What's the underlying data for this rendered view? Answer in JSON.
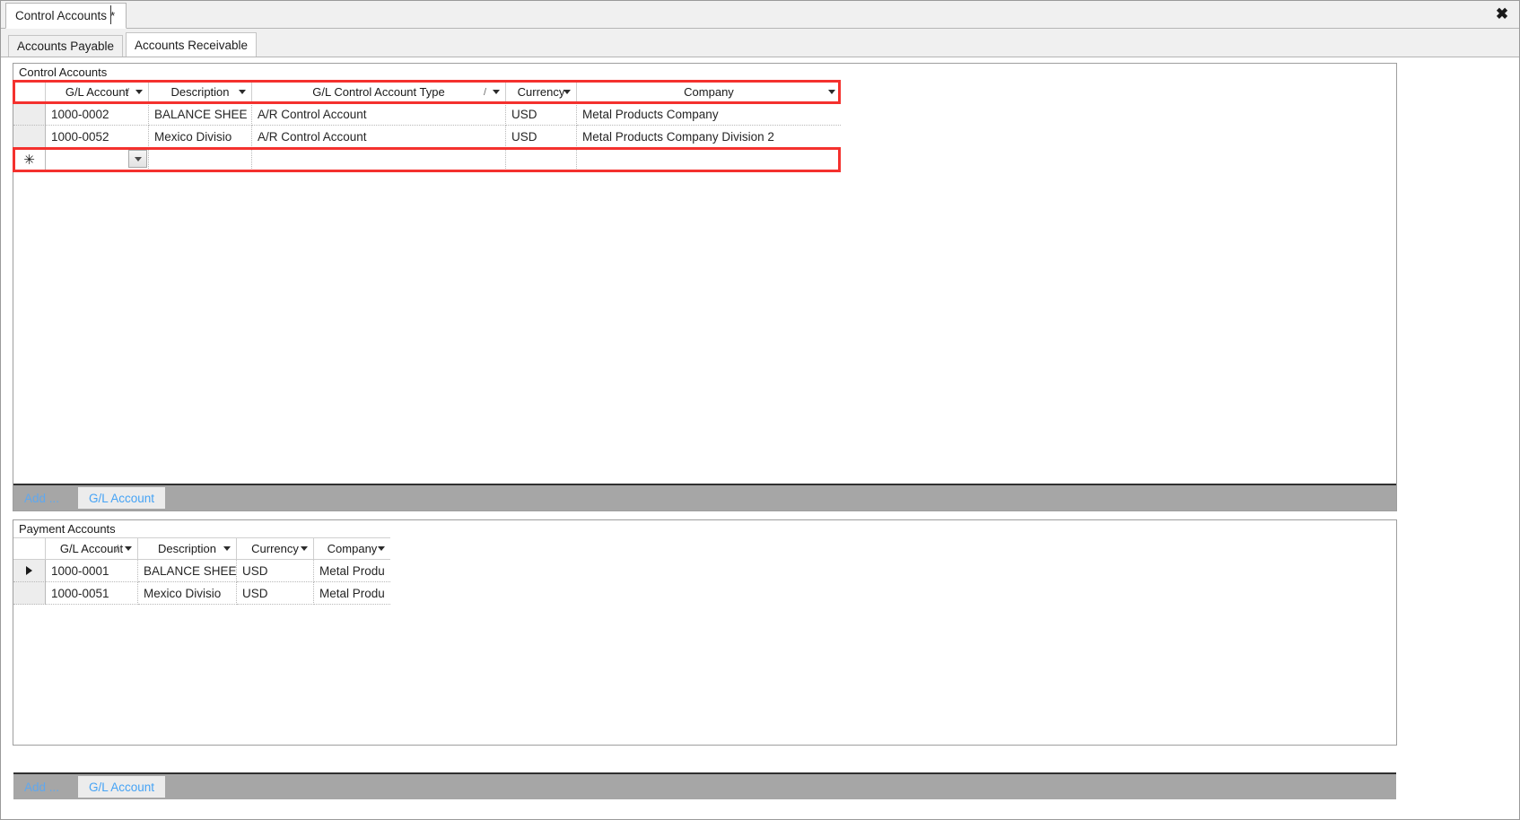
{
  "window": {
    "tab_title": "Control Accounts",
    "tab_dirty_marker": "*",
    "close_icon": "close-icon",
    "close_glyph": "✖"
  },
  "page_tabs": [
    {
      "label": "Accounts Payable",
      "active": false
    },
    {
      "label": "Accounts Receivable",
      "active": true
    }
  ],
  "control_accounts": {
    "title": "Control Accounts",
    "columns": [
      {
        "label": "G/L Account",
        "sortable": true,
        "filter": true
      },
      {
        "label": "Description",
        "sortable": false,
        "filter": true
      },
      {
        "label": "G/L Control Account Type",
        "sortable": true,
        "filter": true
      },
      {
        "label": "Currency",
        "sortable": false,
        "filter": true
      },
      {
        "label": "Company",
        "sortable": false,
        "filter": true
      }
    ],
    "rows": [
      {
        "gl_account": "1000-0002",
        "description": "BALANCE SHEE",
        "type": "A/R Control Account",
        "currency": "USD",
        "company": "Metal Products Company"
      },
      {
        "gl_account": "1000-0052",
        "description": "Mexico Divisio",
        "type": "A/R Control Account",
        "currency": "USD",
        "company": "Metal Products Company Division 2"
      }
    ],
    "new_row": {
      "marker": "✳",
      "gl_account_value": "",
      "gl_account_placeholder": "",
      "dropdown_icon": "chevron-down-icon"
    },
    "add_bar": {
      "add_label": "Add ...",
      "button_label": "G/L Account"
    }
  },
  "payment_accounts": {
    "title": "Payment Accounts",
    "columns": [
      {
        "label": "G/L Account",
        "sortable": true,
        "filter": true
      },
      {
        "label": "Description",
        "sortable": false,
        "filter": true
      },
      {
        "label": "Currency",
        "sortable": false,
        "filter": true
      },
      {
        "label": "Company",
        "sortable": false,
        "filter": true
      }
    ],
    "rows": [
      {
        "selected": true,
        "gl_account": "1000-0001",
        "description": "BALANCE SHEE",
        "currency": "USD",
        "company": "Metal Produ"
      },
      {
        "selected": false,
        "gl_account": "1000-0051",
        "description": "Mexico Divisio",
        "currency": "USD",
        "company": "Metal Produ"
      }
    ],
    "add_bar": {
      "add_label": "Add ...",
      "button_label": "G/L Account"
    }
  },
  "annotations": {
    "highlight_color": "#f4312e",
    "boxes": [
      {
        "name": "control-accounts-header-highlight"
      },
      {
        "name": "control-accounts-newrow-highlight"
      }
    ]
  }
}
